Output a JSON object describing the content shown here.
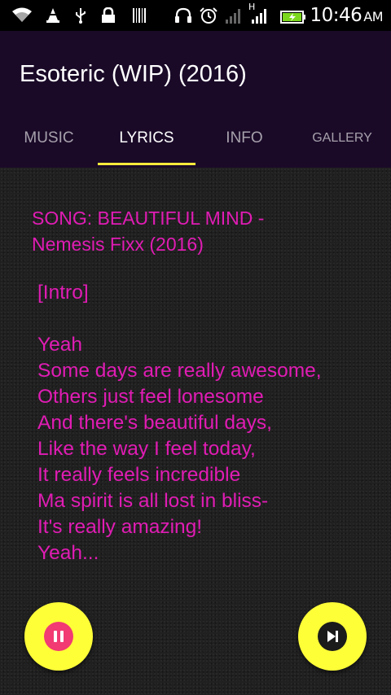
{
  "status_bar": {
    "time": "10:46",
    "ampm": "AM",
    "network_type": "H",
    "icons": [
      "wifi-icon",
      "vlc-cone-icon",
      "usb-icon",
      "lock-icon",
      "barcode-icon",
      "headset-icon",
      "alarm-icon",
      "signal-icon",
      "signal-icon",
      "battery-charging-icon"
    ]
  },
  "app_bar": {
    "title": "Esoteric (WIP) (2016)"
  },
  "tabs": [
    {
      "label": "MUSIC",
      "active": false
    },
    {
      "label": "LYRICS",
      "active": true
    },
    {
      "label": "INFO",
      "active": false
    },
    {
      "label": "GALLERY",
      "active": false
    }
  ],
  "song": {
    "title_line1": "SONG: BEAUTIFUL MIND -",
    "title_line2": "Nemesis Fixx (2016)",
    "lyrics": [
      "[Intro]",
      "",
      "Yeah",
      "Some days are really awesome,",
      "Others just feel lonesome",
      "And there's beautiful days,",
      "Like the way I feel today,",
      "It really feels incredible",
      "Ma spirit is all lost in bliss-",
      "It's really amazing!",
      "Yeah..."
    ]
  },
  "controls": {
    "pause_icon": "pause-icon",
    "next_icon": "skip-next-icon"
  },
  "colors": {
    "accent": "#ffff38",
    "lyrics": "#e01cb4",
    "app_bar": "#1a0a28",
    "pause_inner": "#f23a73",
    "next_inner": "#1b1b1b"
  }
}
